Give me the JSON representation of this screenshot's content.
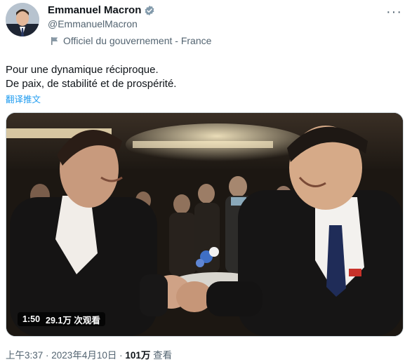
{
  "author": {
    "display_name": "Emmanuel Macron",
    "handle": "@EmmanuelMacron",
    "label": "Officiel du gouvernement - France",
    "verified_icon": "verified-badge-icon",
    "label_icon": "flag-icon"
  },
  "menu": {
    "icon": "more-icon",
    "glyph": "···"
  },
  "tweet": {
    "lines": [
      "Pour une dynamique réciproque.",
      "De paix, de stabilité et de prospérité."
    ],
    "translate_label": "翻译推文"
  },
  "media": {
    "duration": "1:50",
    "views": "29.1万 次观看"
  },
  "meta": {
    "time": "上午3:37",
    "sep1": " · ",
    "date": "2023年4月10日",
    "sep2": " · ",
    "views_count": "101万",
    "views_label": " 查看"
  },
  "colors": {
    "accent": "#1d9bf0",
    "secondary_text": "#536471",
    "text": "#0f1419"
  }
}
